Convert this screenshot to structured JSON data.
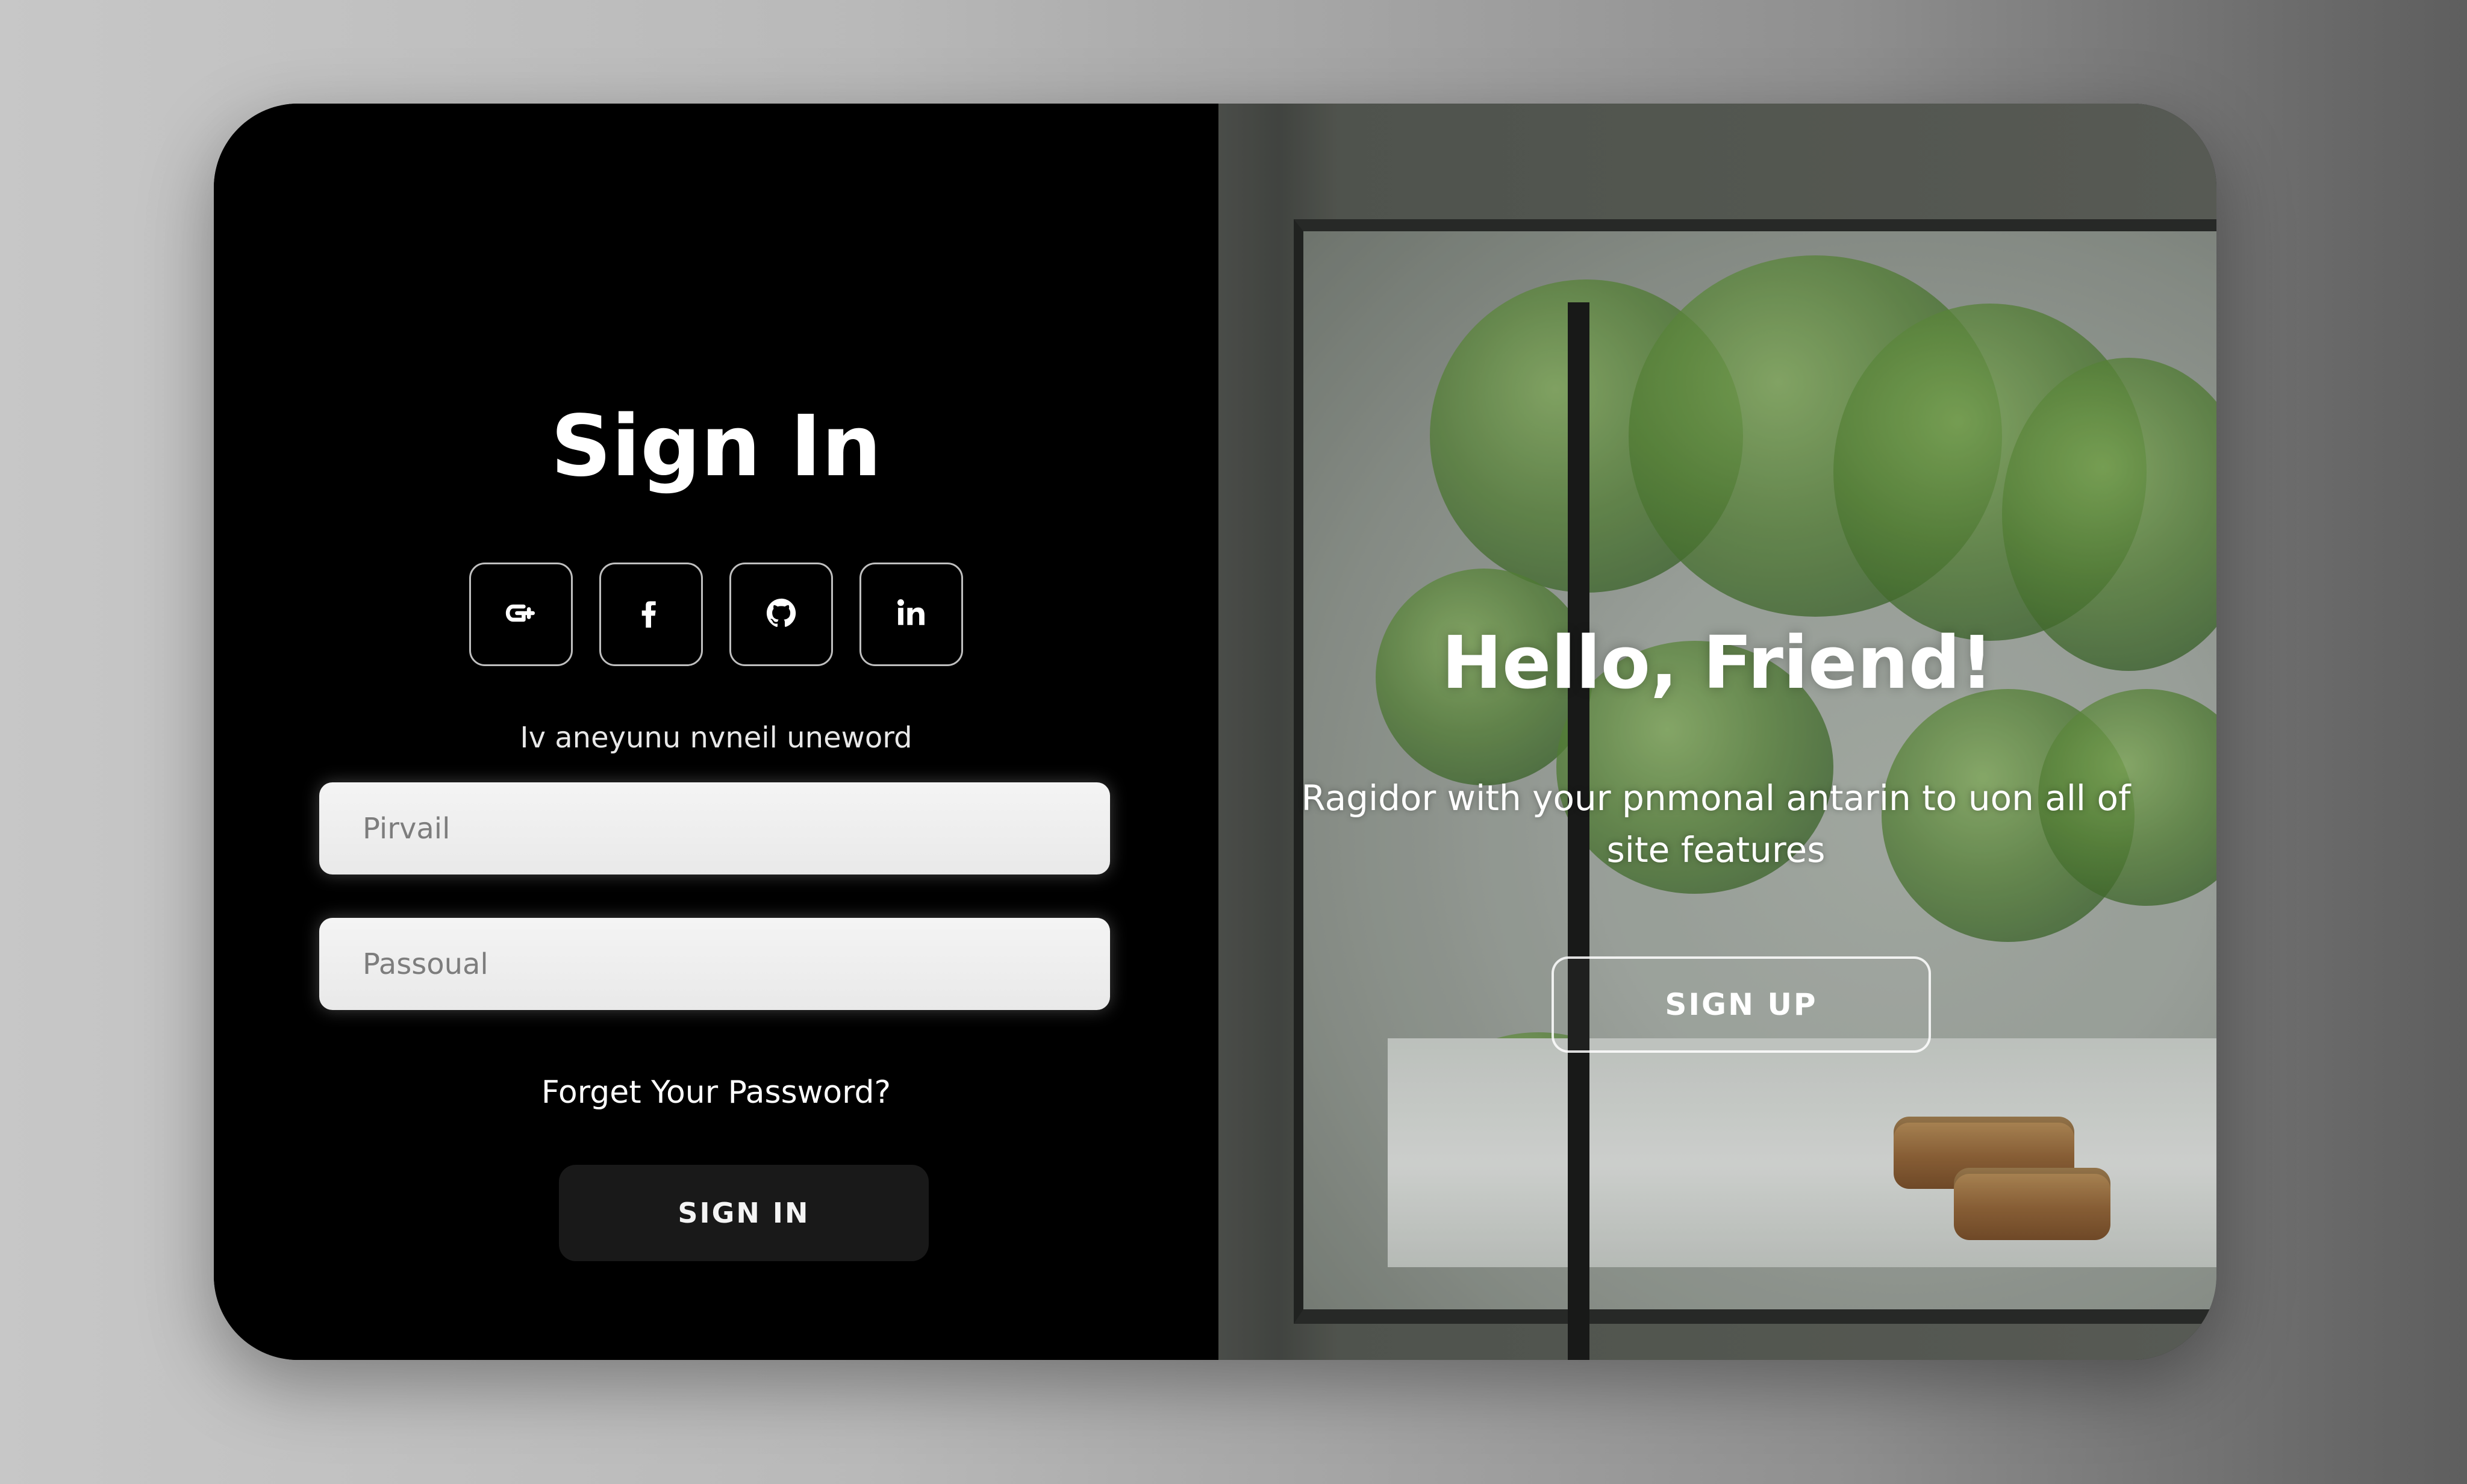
{
  "left_panel": {
    "title": "Sign In",
    "social": [
      {
        "name": "google",
        "label": "G+"
      },
      {
        "name": "facebook",
        "label": "f"
      },
      {
        "name": "github",
        "label": "github"
      },
      {
        "name": "linkedin",
        "label": "in"
      }
    ],
    "hint": "Iv aneyunu nvneil uneword",
    "email_placeholder": "Pirvail",
    "password_placeholder": "Passoual",
    "forgot_link": "Forget Your Password?",
    "signin_label": "SIGN IN"
  },
  "right_panel": {
    "title": "Hello, Friend!",
    "description": "Ragidor with your pnmonal antarin to uon all of site features",
    "signup_label": "SIGN UP"
  },
  "colors": {
    "background_left": "#c7c7c7",
    "background_right": "#5e5e5e",
    "card_left": "#000000",
    "input_bg": "#f4f4f4",
    "signin_btn_bg": "#191919",
    "text": "#ffffff"
  },
  "icons": {
    "social_google": "google-icon",
    "social_facebook": "facebook-icon",
    "social_github": "github-icon",
    "social_linkedin": "linkedin-icon"
  }
}
